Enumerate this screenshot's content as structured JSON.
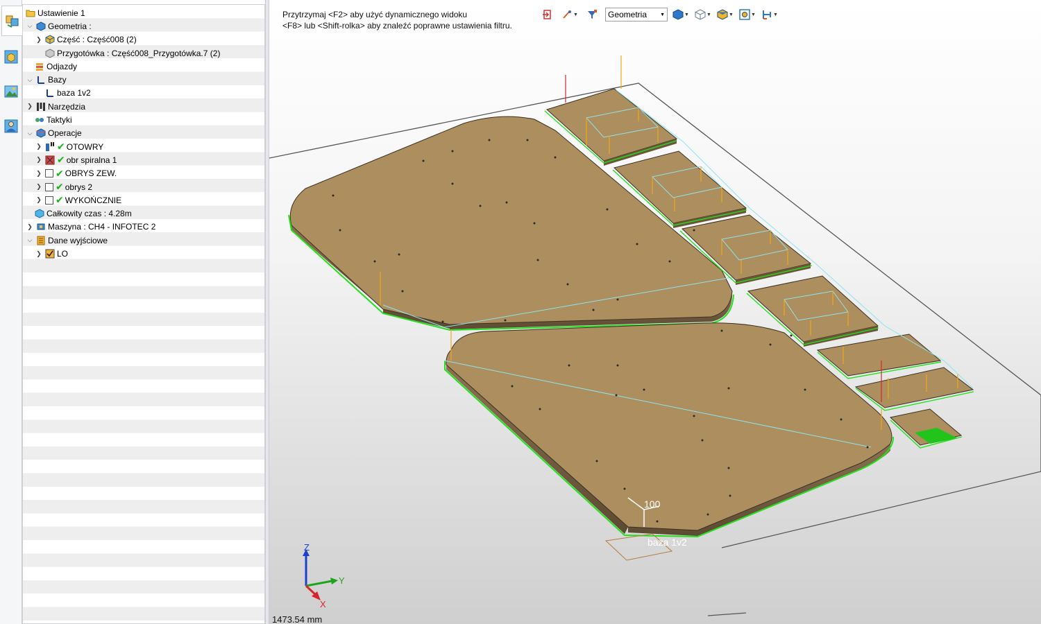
{
  "tree": {
    "items": [
      {
        "label": "Ustawienie 1"
      },
      {
        "label": "Geometria :"
      },
      {
        "label": "Część : Część008 (2)"
      },
      {
        "label": "Przygotówka : Część008_Przygotówka.7 (2)"
      },
      {
        "label": "Odjazdy"
      },
      {
        "label": "Bazy"
      },
      {
        "label": "baza 1v2"
      },
      {
        "label": "Narzędzia"
      },
      {
        "label": "Taktyki"
      },
      {
        "label": "Operacje"
      },
      {
        "label": "OTOWRY"
      },
      {
        "label": "obr spiralna 1"
      },
      {
        "label": "OBRYS ZEW."
      },
      {
        "label": "obrys 2"
      },
      {
        "label": "WYKOŃCZNIE"
      },
      {
        "label": "Całkowity czas : 4.28m"
      },
      {
        "label": "Maszyna : CH4 - INFOTEC 2"
      },
      {
        "label": "Dane wyjściowe"
      },
      {
        "label": "LO"
      }
    ]
  },
  "viewport": {
    "hint_line1": "Przytrzymaj <F2> aby użyć dynamicznego widoku",
    "hint_line2": "<F8> lub <Shift-rolka> aby znaleźć poprawne ustawienia filtru.",
    "filter_combo": "Geometria",
    "base_label": "baza 1v2",
    "base_number": "100",
    "axis_x": "X",
    "axis_y": "Y",
    "axis_z": "Z",
    "measure": "1473.54 mm"
  },
  "colors": {
    "part_fill": "#ad8e5f",
    "part_edge": "#3b3022",
    "toolpath_green": "#22e01c",
    "toolpath_cyan": "#8fe3f0",
    "tool_orange": "#f0a817"
  }
}
